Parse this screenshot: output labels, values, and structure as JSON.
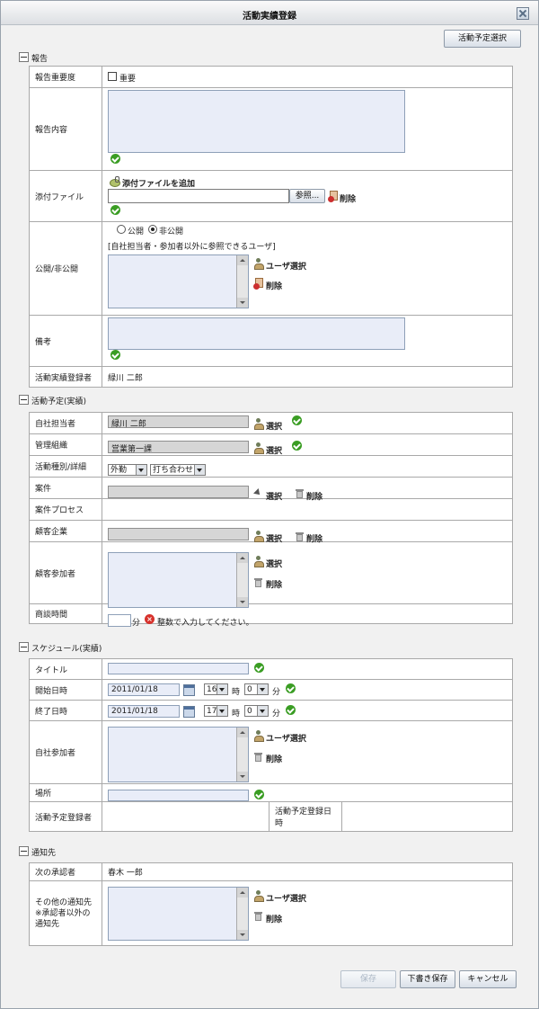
{
  "window": {
    "title": "活動実績登録"
  },
  "top_button": "活動予定選択",
  "sections": {
    "report": "報告",
    "plan": "活動予定(実績)",
    "schedule": "スケジュール(実績)",
    "notify": "通知先"
  },
  "report": {
    "importance_label": "報告重要度",
    "importance_checkbox": "重要",
    "content_label": "報告内容",
    "attach_label": "添付ファイル",
    "attach_add": "添付ファイルを追加",
    "browse_button": "参照...",
    "attach_delete": "削除",
    "visibility_label": "公開/非公開",
    "public_option": "公開",
    "private_option": "非公開",
    "visibility_note": "[自社担当者・参加者以外に参照できるユーザ]",
    "user_select": "ユーザ選択",
    "user_delete": "削除",
    "remarks_label": "備考",
    "registrant_label": "活動実績登録者",
    "registrant_value": "緑川 二郎"
  },
  "plan": {
    "owner_label": "自社担当者",
    "owner_value": "緑川 二郎",
    "org_label": "管理組織",
    "org_value": "営業第一課",
    "type_label": "活動種別/詳細",
    "type_value": "外勤",
    "detail_value": "打ち合わせ",
    "case_label": "案件",
    "process_label": "案件プロセス",
    "client_label": "顧客企業",
    "participants_label": "顧客参加者",
    "time_label": "商談時間",
    "time_unit": "分",
    "time_error": "整数で入力してください。",
    "select": "選択",
    "delete": "削除"
  },
  "schedule": {
    "title_label": "タイトル",
    "start_label": "開始日時",
    "start_date": "2011/01/18",
    "start_hour": "16",
    "start_min": "0",
    "end_label": "終了日時",
    "end_date": "2011/01/18",
    "end_hour": "17",
    "end_min": "0",
    "hour_unit": "時",
    "min_unit": "分",
    "participants_label": "自社参加者",
    "user_select": "ユーザ選択",
    "delete": "削除",
    "place_label": "場所",
    "plan_registrant_label": "活動予定登録者",
    "plan_registered_label": "活動予定登録日時"
  },
  "notify": {
    "approver_label": "次の承認者",
    "approver_value": "春木 一郎",
    "other_label": "その他の通知先 ※承認者以外の通知先",
    "user_select": "ユーザ選択",
    "delete": "削除"
  },
  "footer": {
    "save": "保存",
    "draft_save": "下書き保存",
    "cancel": "キャンセル"
  }
}
